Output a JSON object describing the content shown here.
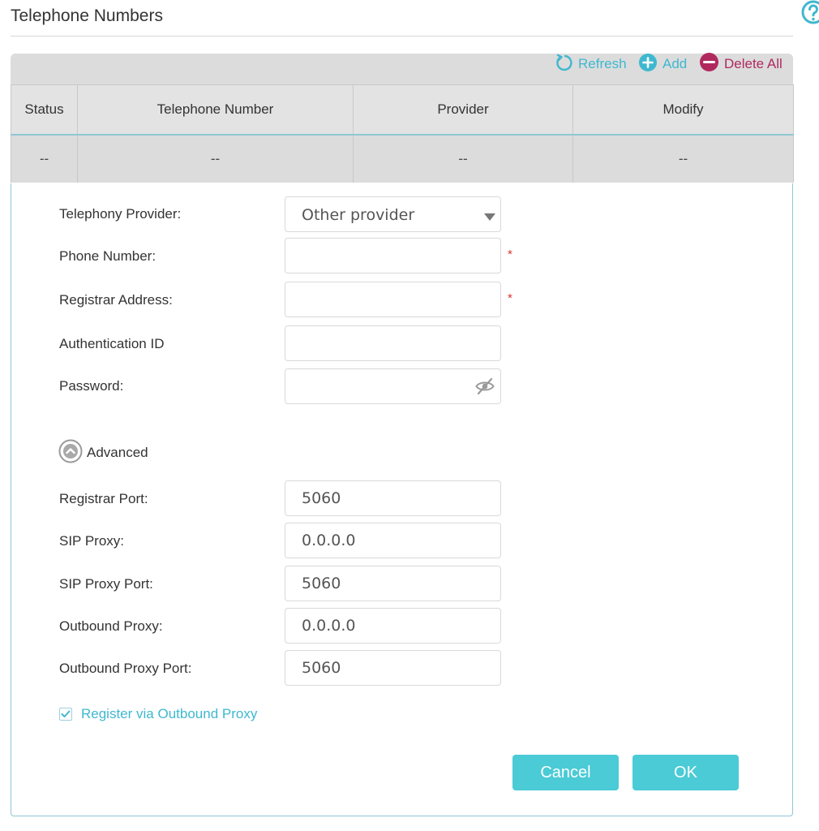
{
  "page": {
    "title": "Telephone Numbers"
  },
  "toolbar": {
    "refresh_label": "Refresh",
    "add_label": "Add",
    "delete_all_label": "Delete All"
  },
  "table": {
    "columns": [
      "Status",
      "Telephone Number",
      "Provider",
      "Modify"
    ],
    "rows": [
      [
        "--",
        "--",
        "--",
        "--"
      ]
    ]
  },
  "form": {
    "telephony_provider": {
      "label": "Telephony Provider:",
      "value": "Other provider"
    },
    "phone_number": {
      "label": "Phone Number:",
      "value": "",
      "required_mark": "*"
    },
    "registrar_address": {
      "label": "Registrar Address:",
      "value": "",
      "required_mark": "*"
    },
    "authentication_id": {
      "label": "Authentication ID",
      "value": ""
    },
    "password": {
      "label": "Password:",
      "value": ""
    },
    "advanced_label": "Advanced",
    "registrar_port": {
      "label": "Registrar Port:",
      "value": "5060"
    },
    "sip_proxy": {
      "label": "SIP Proxy:",
      "value": "0.0.0.0"
    },
    "sip_proxy_port": {
      "label": "SIP Proxy Port:",
      "value": "5060"
    },
    "outbound_proxy": {
      "label": "Outbound Proxy:",
      "value": "0.0.0.0"
    },
    "outbound_proxy_port": {
      "label": "Outbound Proxy Port:",
      "value": "5060"
    },
    "register_via_outbound_proxy": {
      "label": "Register via Outbound Proxy",
      "checked": true
    }
  },
  "actions": {
    "cancel_label": "Cancel",
    "ok_label": "OK"
  },
  "colors": {
    "accent": "#4acbd6",
    "link": "#3fb8cf",
    "danger": "#b0295e",
    "required": "#e0312f"
  },
  "icons": {
    "help": "help-icon",
    "refresh": "refresh-icon",
    "add": "plus-circle-icon",
    "delete_all": "minus-circle-icon",
    "select_caret": "caret-down-icon",
    "password_toggle": "eye-slash-icon",
    "advanced_toggle": "chevron-up-circle-icon",
    "checkbox": "checkmark-icon"
  }
}
